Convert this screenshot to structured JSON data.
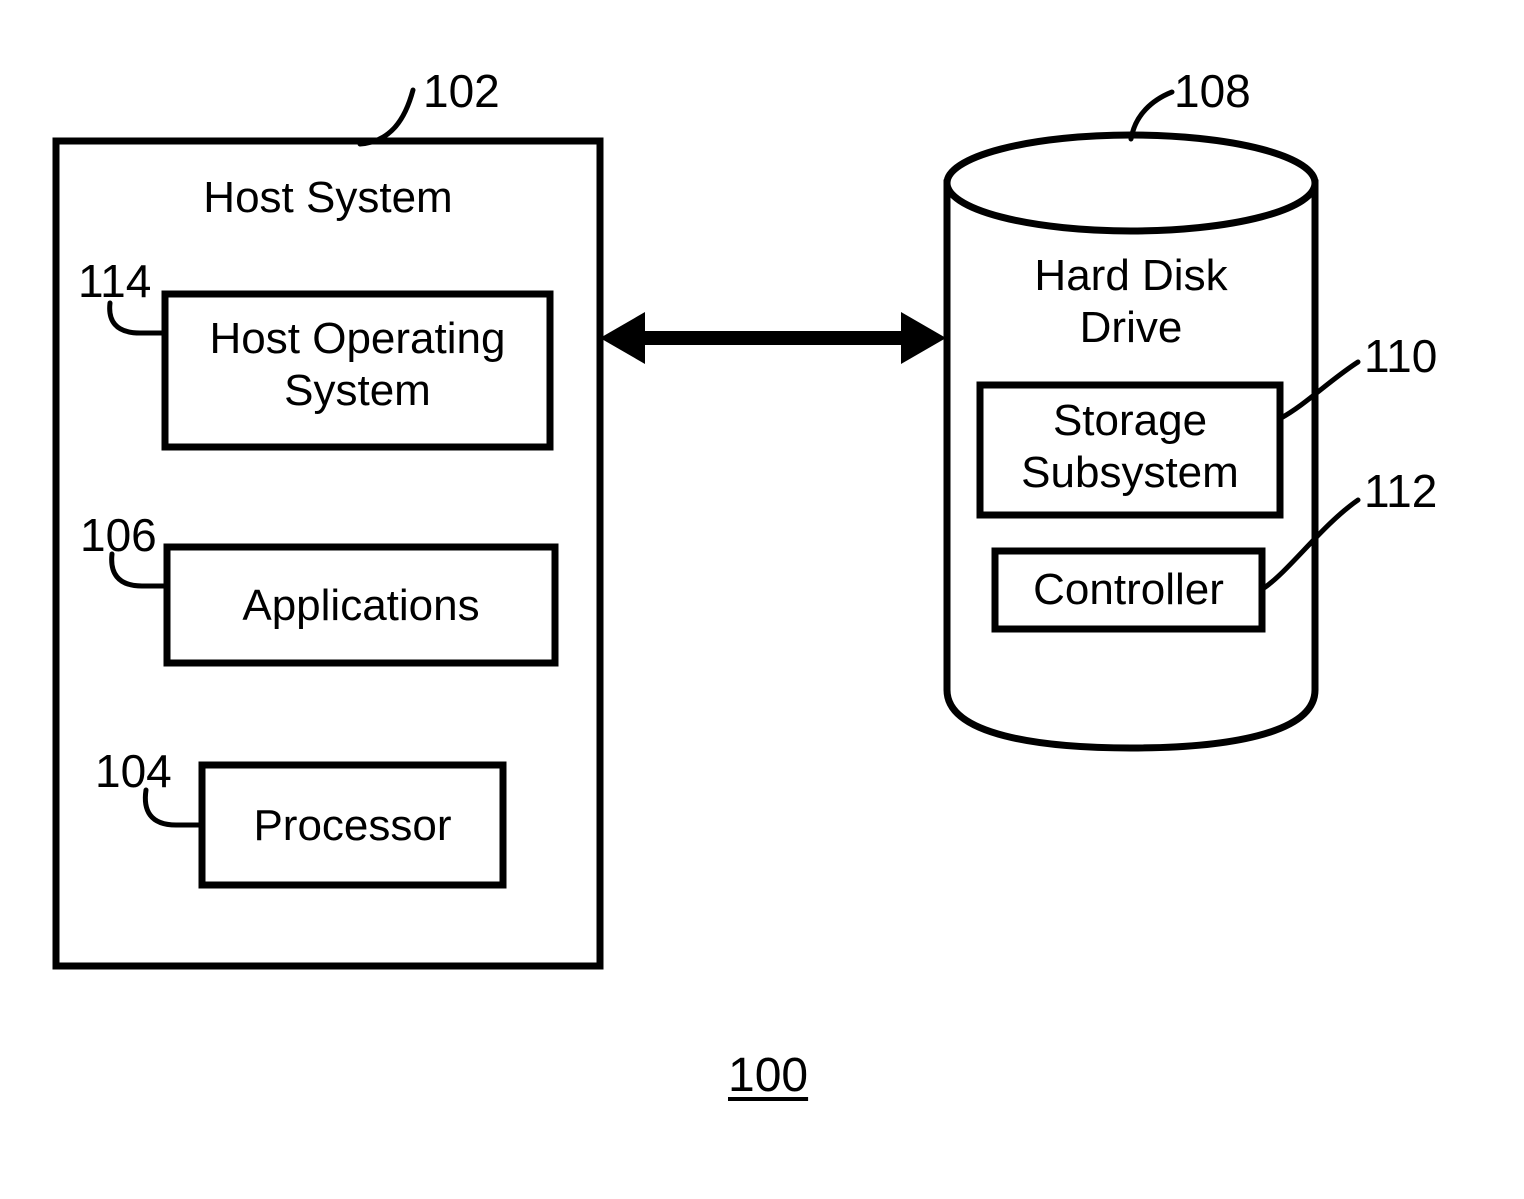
{
  "figure": {
    "number": "100",
    "title_number_label": "100"
  },
  "host_system": {
    "label": "Host System",
    "ref": "102",
    "components": [
      {
        "name": "host-operating-system",
        "label": "Host Operating\nSystem",
        "label_line1": "Host Operating",
        "label_line2": "System",
        "ref": "114"
      },
      {
        "name": "applications",
        "label": "Applications",
        "ref": "106"
      },
      {
        "name": "processor",
        "label": "Processor",
        "ref": "104"
      }
    ]
  },
  "hard_disk_drive": {
    "label": "Hard Disk\nDrive",
    "label_line1": "Hard Disk",
    "label_line2": "Drive",
    "ref": "108",
    "components": [
      {
        "name": "storage-subsystem",
        "label": "Storage\nSubsystem",
        "label_line1": "Storage",
        "label_line2": "Subsystem",
        "ref": "110"
      },
      {
        "name": "controller",
        "label": "Controller",
        "ref": "112"
      }
    ]
  },
  "connection": {
    "name": "host-to-drive-bidirectional-link",
    "type": "double-headed-arrow",
    "description": ""
  },
  "colors": {
    "stroke": "#000000",
    "fill": "#ffffff",
    "background": "#ffffff"
  }
}
